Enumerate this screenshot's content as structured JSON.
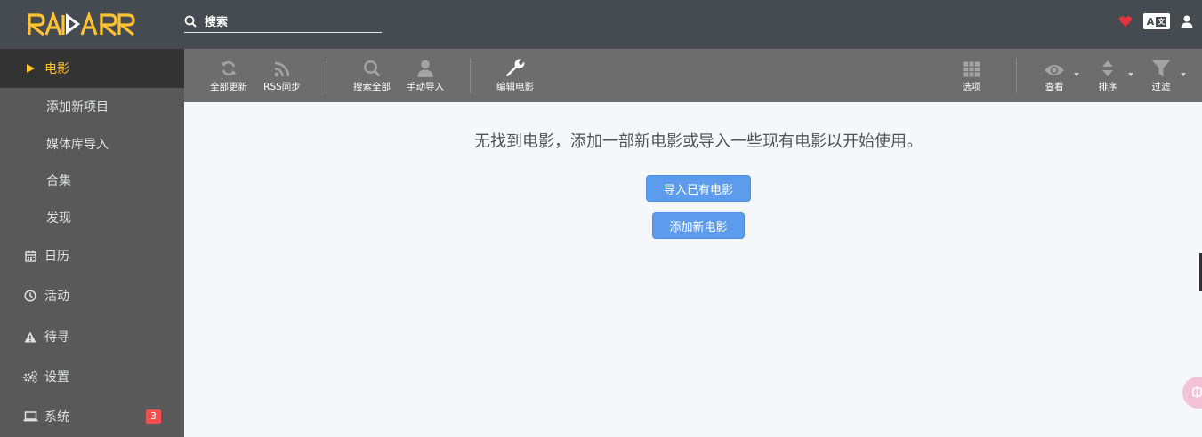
{
  "app": {
    "logo_text": "RADARR",
    "accent_color": "#ffc230",
    "header_bg": "#464b51",
    "sidebar_bg": "#595959"
  },
  "header": {
    "search_placeholder": "搜索",
    "icons": [
      "heart-icon",
      "translate-icon",
      "user-icon"
    ]
  },
  "sidebar": {
    "movies": "电影",
    "sub_items": [
      "添加新项目",
      "媒体库导入",
      "合集",
      "发现"
    ],
    "calendar": "日历",
    "activity": "活动",
    "wanted": "待寻",
    "settings": "设置",
    "system": "系统",
    "system_badge": "3"
  },
  "toolbar": {
    "update_all": "全部更新",
    "rss_sync": "RSS同步",
    "search_all": "搜索全部",
    "manual_import": "手动导入",
    "edit_movies": "编辑电影",
    "options": "选项",
    "view": "查看",
    "sort": "排序",
    "filter": "过滤"
  },
  "main": {
    "empty_message": "无找到电影，添加一部新电影或导入一些现有电影以开始使用。",
    "import_button": "导入已有电影",
    "add_button": "添加新电影"
  }
}
